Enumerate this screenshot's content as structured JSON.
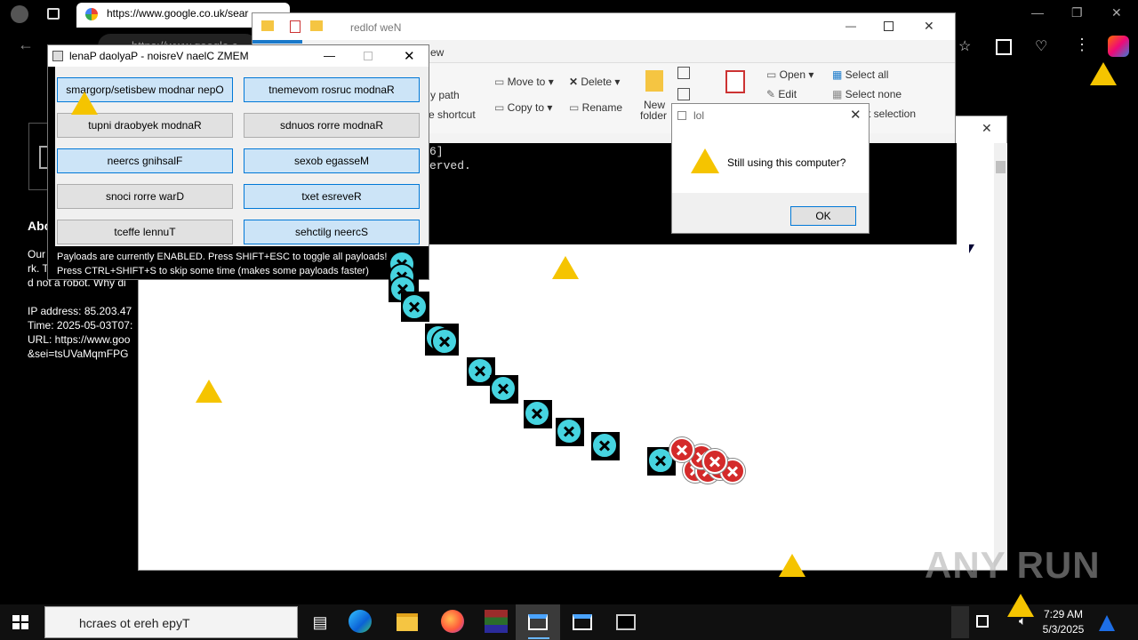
{
  "browser": {
    "tab_url": "https://www.google.co.uk/sear",
    "address_text": "https://www.google.c",
    "page_heading": "Abo",
    "page_lines": [
      "Our",
      "rk. T",
      "d not a robot. Why di"
    ],
    "ip_line": "IP address: 85.203.47",
    "time_line": "Time: 2025-05-03T07:",
    "url_line": "URL: https://www.goo",
    "sei_line": "&sei=tsUVaMqmFPG"
  },
  "explorer": {
    "title": "redlof weN",
    "view_tab": "ew",
    "path_text": "y path",
    "shortcut_text": "e shortcut",
    "move_to": "Move to",
    "copy_to": "Copy to",
    "delete": "Delete",
    "rename": "Rename",
    "new_folder": "New",
    "new_folder2": "folder",
    "properties": "Properties",
    "open": "Open",
    "edit": "Edit",
    "select_all": "Select all",
    "select_none": "Select none",
    "invert_selection": "t selection"
  },
  "console": {
    "line1": "6]",
    "line2": "erved."
  },
  "memz": {
    "title": "lenaP daolyaP - noisreV naelC ZMEM",
    "buttons": [
      {
        "label": "smargorp/setisbew modnar nepO",
        "state": "on"
      },
      {
        "label": "tnemevom rosruc modnaR",
        "state": "on"
      },
      {
        "label": "tupni draobyek modnaR",
        "state": "off"
      },
      {
        "label": "sdnuos rorre modnaR",
        "state": "off"
      },
      {
        "label": "neercs gnihsalF",
        "state": "on"
      },
      {
        "label": "sexob egasseM",
        "state": "on"
      },
      {
        "label": "snoci rorre warD",
        "state": "off"
      },
      {
        "label": "txet esreveR",
        "state": "on"
      },
      {
        "label": "tceffe lennuT",
        "state": "off"
      },
      {
        "label": "sehctilg neercS",
        "state": "on"
      }
    ],
    "info1": "Payloads are currently ENABLED. Press SHIFT+ESC to toggle all payloads!",
    "info2": "Press CTRL+SHIFT+S to skip some time (makes some payloads faster)"
  },
  "dialog": {
    "title": "lol",
    "message": "Still using this computer?",
    "ok": "OK"
  },
  "taskbar": {
    "search_placeholder": "hcraes ot ereh epyT",
    "time": "7:29 AM",
    "date": "5/3/2025"
  },
  "watermark": "ANY RUN",
  "colors": {
    "button_on": "#cce4f7",
    "button_off": "#e1e1e1",
    "warning": "#f5c400",
    "error_cyan": "#46d4e0",
    "error_red": "#d42a2a"
  }
}
